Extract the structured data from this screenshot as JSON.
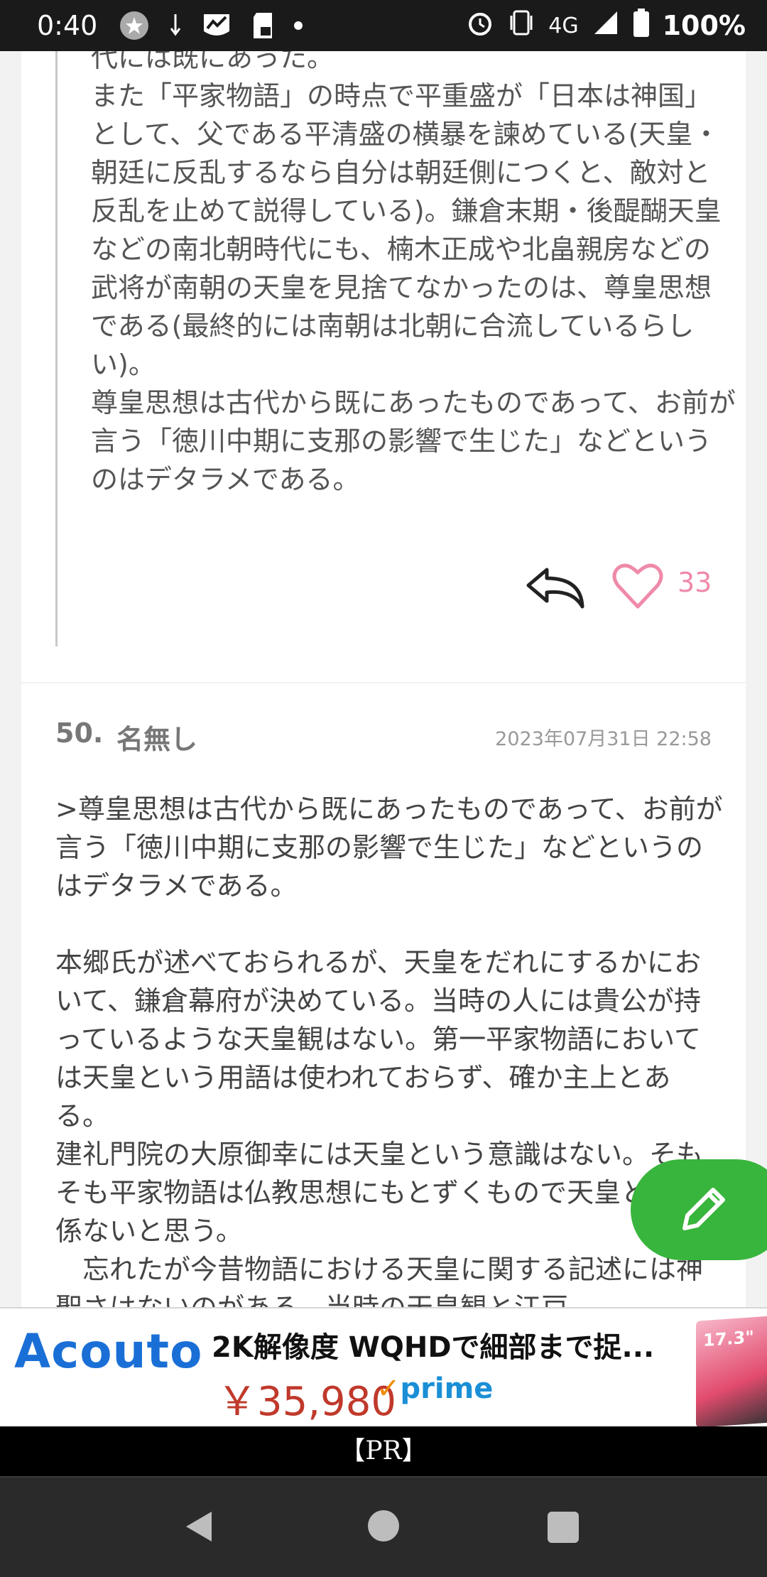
{
  "status_bar": {
    "time": "0:40",
    "network": "4G",
    "battery": "100%",
    "icons": [
      "star-icon",
      "arrow-icon",
      "chart-icon",
      "sd-card-icon",
      "dot-icon",
      "alarm-icon",
      "vibrate-icon",
      "signal-icon",
      "battery-icon"
    ]
  },
  "quoted_post": {
    "text": "代には既にあった。\nまた「平家物語」の時点で平重盛が「日本は神国」として、父である平清盛の横暴を諫めている(天皇・朝廷に反乱するなら自分は朝廷側につくと、敵対と反乱を止めて説得している)。鎌倉末期・後醍醐天皇などの南北朝時代にも、楠木正成や北畠親房などの武将が南朝の天皇を見捨てなかったのは、尊皇思想である(最終的には南朝は北朝に合流しているらしい)。\n尊皇思想は古代から既にあったものであって、お前が言う「徳川中期に支那の影響で生じた」などというのはデタラメである。",
    "like_count": "33"
  },
  "comment": {
    "number": "50.",
    "name": "名無し",
    "date": "2023年07月31日 22:58",
    "body": ">尊皇思想は古代から既にあったものであって、お前が言う「徳川中期に支那の影響で生じた」などというのはデタラメである。\n\n本郷氏が述べておられるが、天皇をだれにするかにおいて、鎌倉幕府が決めている。当時の人には貴公が持っているような天皇観はない。第一平家物語においては天皇という用語は使われておらず、確か主上とある。\n建礼門院の大原御幸には天皇という意識はない。そもそも平家物語は仏教思想にもとずくもので天皇とは関係ないと思う。\n　忘れたが今昔物語における天皇に関する記述には神聖さはないのがある。当時の天皇観と江戸"
  },
  "ad": {
    "brand": "Acouto",
    "title": "2K解像度 WQHDで細部まで捉...",
    "price": "￥35,980",
    "prime_label": "prime",
    "thumb_text": "17.3\"",
    "pr_label": "【PR】"
  },
  "colors": {
    "fab": "#38b53c",
    "like": "#ef8aa9",
    "brand": "#1a6fd6"
  }
}
